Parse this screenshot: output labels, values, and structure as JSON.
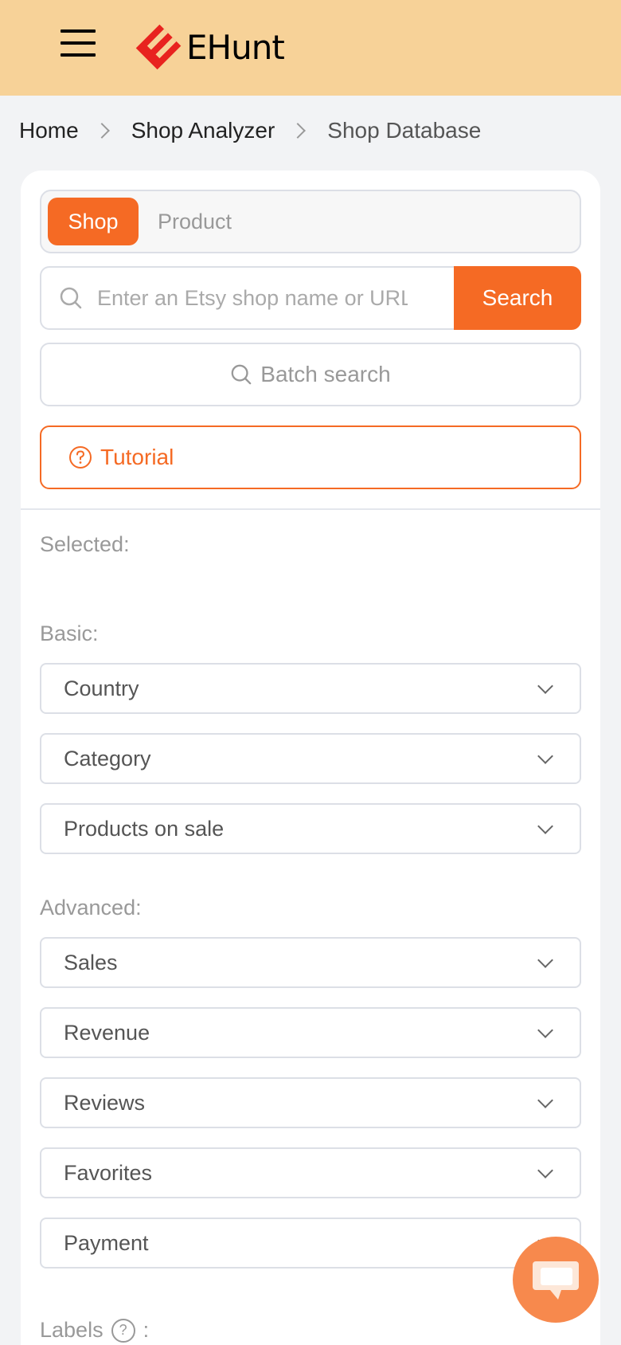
{
  "header": {
    "brand": "EHunt",
    "menu_icon": "hamburger-icon",
    "logo_icon": "ehunt-logo-icon",
    "bg_color": "#f7d298"
  },
  "breadcrumb": {
    "items": [
      "Home",
      "Shop Analyzer",
      "Shop Database"
    ],
    "separator_icon": "chevron-right-icon"
  },
  "tabs": {
    "active": "Shop",
    "inactive": "Product"
  },
  "search": {
    "placeholder": "Enter an Etsy shop name or URL",
    "button_label": "Search",
    "icon": "search-icon"
  },
  "batch_search": {
    "label": "Batch search",
    "icon": "search-icon"
  },
  "tutorial": {
    "label": "Tutorial",
    "icon": "question-circle-icon"
  },
  "filters": {
    "selected_label": "Selected:",
    "basic_label": "Basic:",
    "basic": [
      "Country",
      "Category",
      "Products on sale"
    ],
    "advanced_label": "Advanced:",
    "advanced": [
      "Sales",
      "Revenue",
      "Reviews",
      "Favorites",
      "Payment"
    ],
    "labels_label": "Labels",
    "labels_suffix": ":",
    "dropdown_icon": "chevron-down-icon"
  },
  "chat": {
    "icon": "chat-bubble-icon"
  },
  "colors": {
    "accent": "#f56a24",
    "chat": "#f7894d"
  }
}
